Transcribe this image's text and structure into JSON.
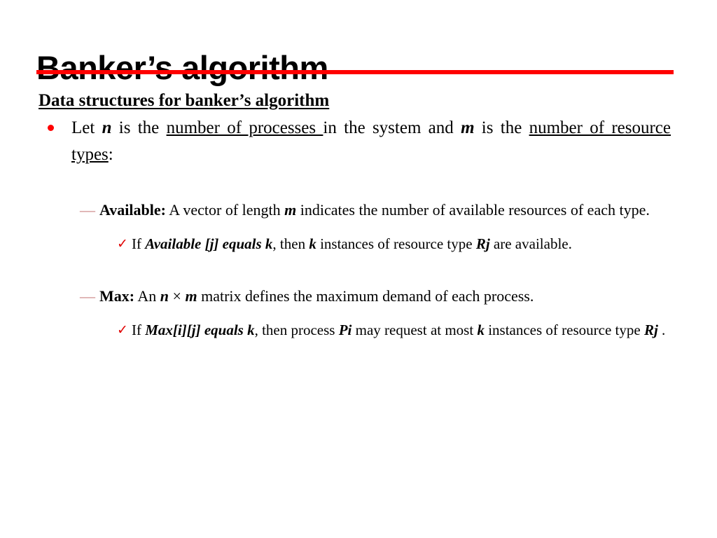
{
  "slide": {
    "title": "Banker’s algorithm",
    "accent_color": "#ff0000",
    "dash_color": "#cb8383",
    "check_color": "#e00000",
    "background": "#ffffff",
    "subtitle": "Data structures for banker’s algorithm",
    "bullet_1": {
      "marker": "round-bullet",
      "seg_1": "Let ",
      "seg_2_italic": "n",
      "seg_3": " is the ",
      "seg_4_underline": "number of processes ",
      "seg_5": "in the system and ",
      "seg_6_italic": "m",
      "seg_7": " is the ",
      "seg_8_underline": "number of resource types",
      "seg_9": ":"
    },
    "available": {
      "marker": "em-dash",
      "label": "Available:",
      "seg_1": " A vector of length ",
      "seg_2_italic": "m",
      "seg_3": " indicates the number of available resources of each type.",
      "sub": {
        "marker": "check-mark",
        "seg_1": "If ",
        "seg_2_italic": "Available [j] equals k",
        "seg_3": ", then ",
        "seg_4_italic": "k",
        "seg_5": " instances of resource type ",
        "seg_6_italic": "Rj",
        "seg_7": " are available."
      }
    },
    "max": {
      "marker": "em-dash",
      "label": "Max:",
      "seg_1": " An ",
      "seg_2_italic": "n",
      "seg_3": " × ",
      "seg_4_italic": "m",
      "seg_5": " matrix defines the maximum demand of each process.",
      "sub": {
        "marker": "check-mark",
        "seg_1": "If ",
        "seg_2_italic": "Max[i][j] equals k",
        "seg_3": ", then process ",
        "seg_4_italic": "Pi",
        "seg_5": " may request at most ",
        "seg_6_italic": "k",
        "seg_7": " instances of resource type ",
        "seg_8_italic": "Rj",
        "seg_9": " ."
      }
    }
  }
}
